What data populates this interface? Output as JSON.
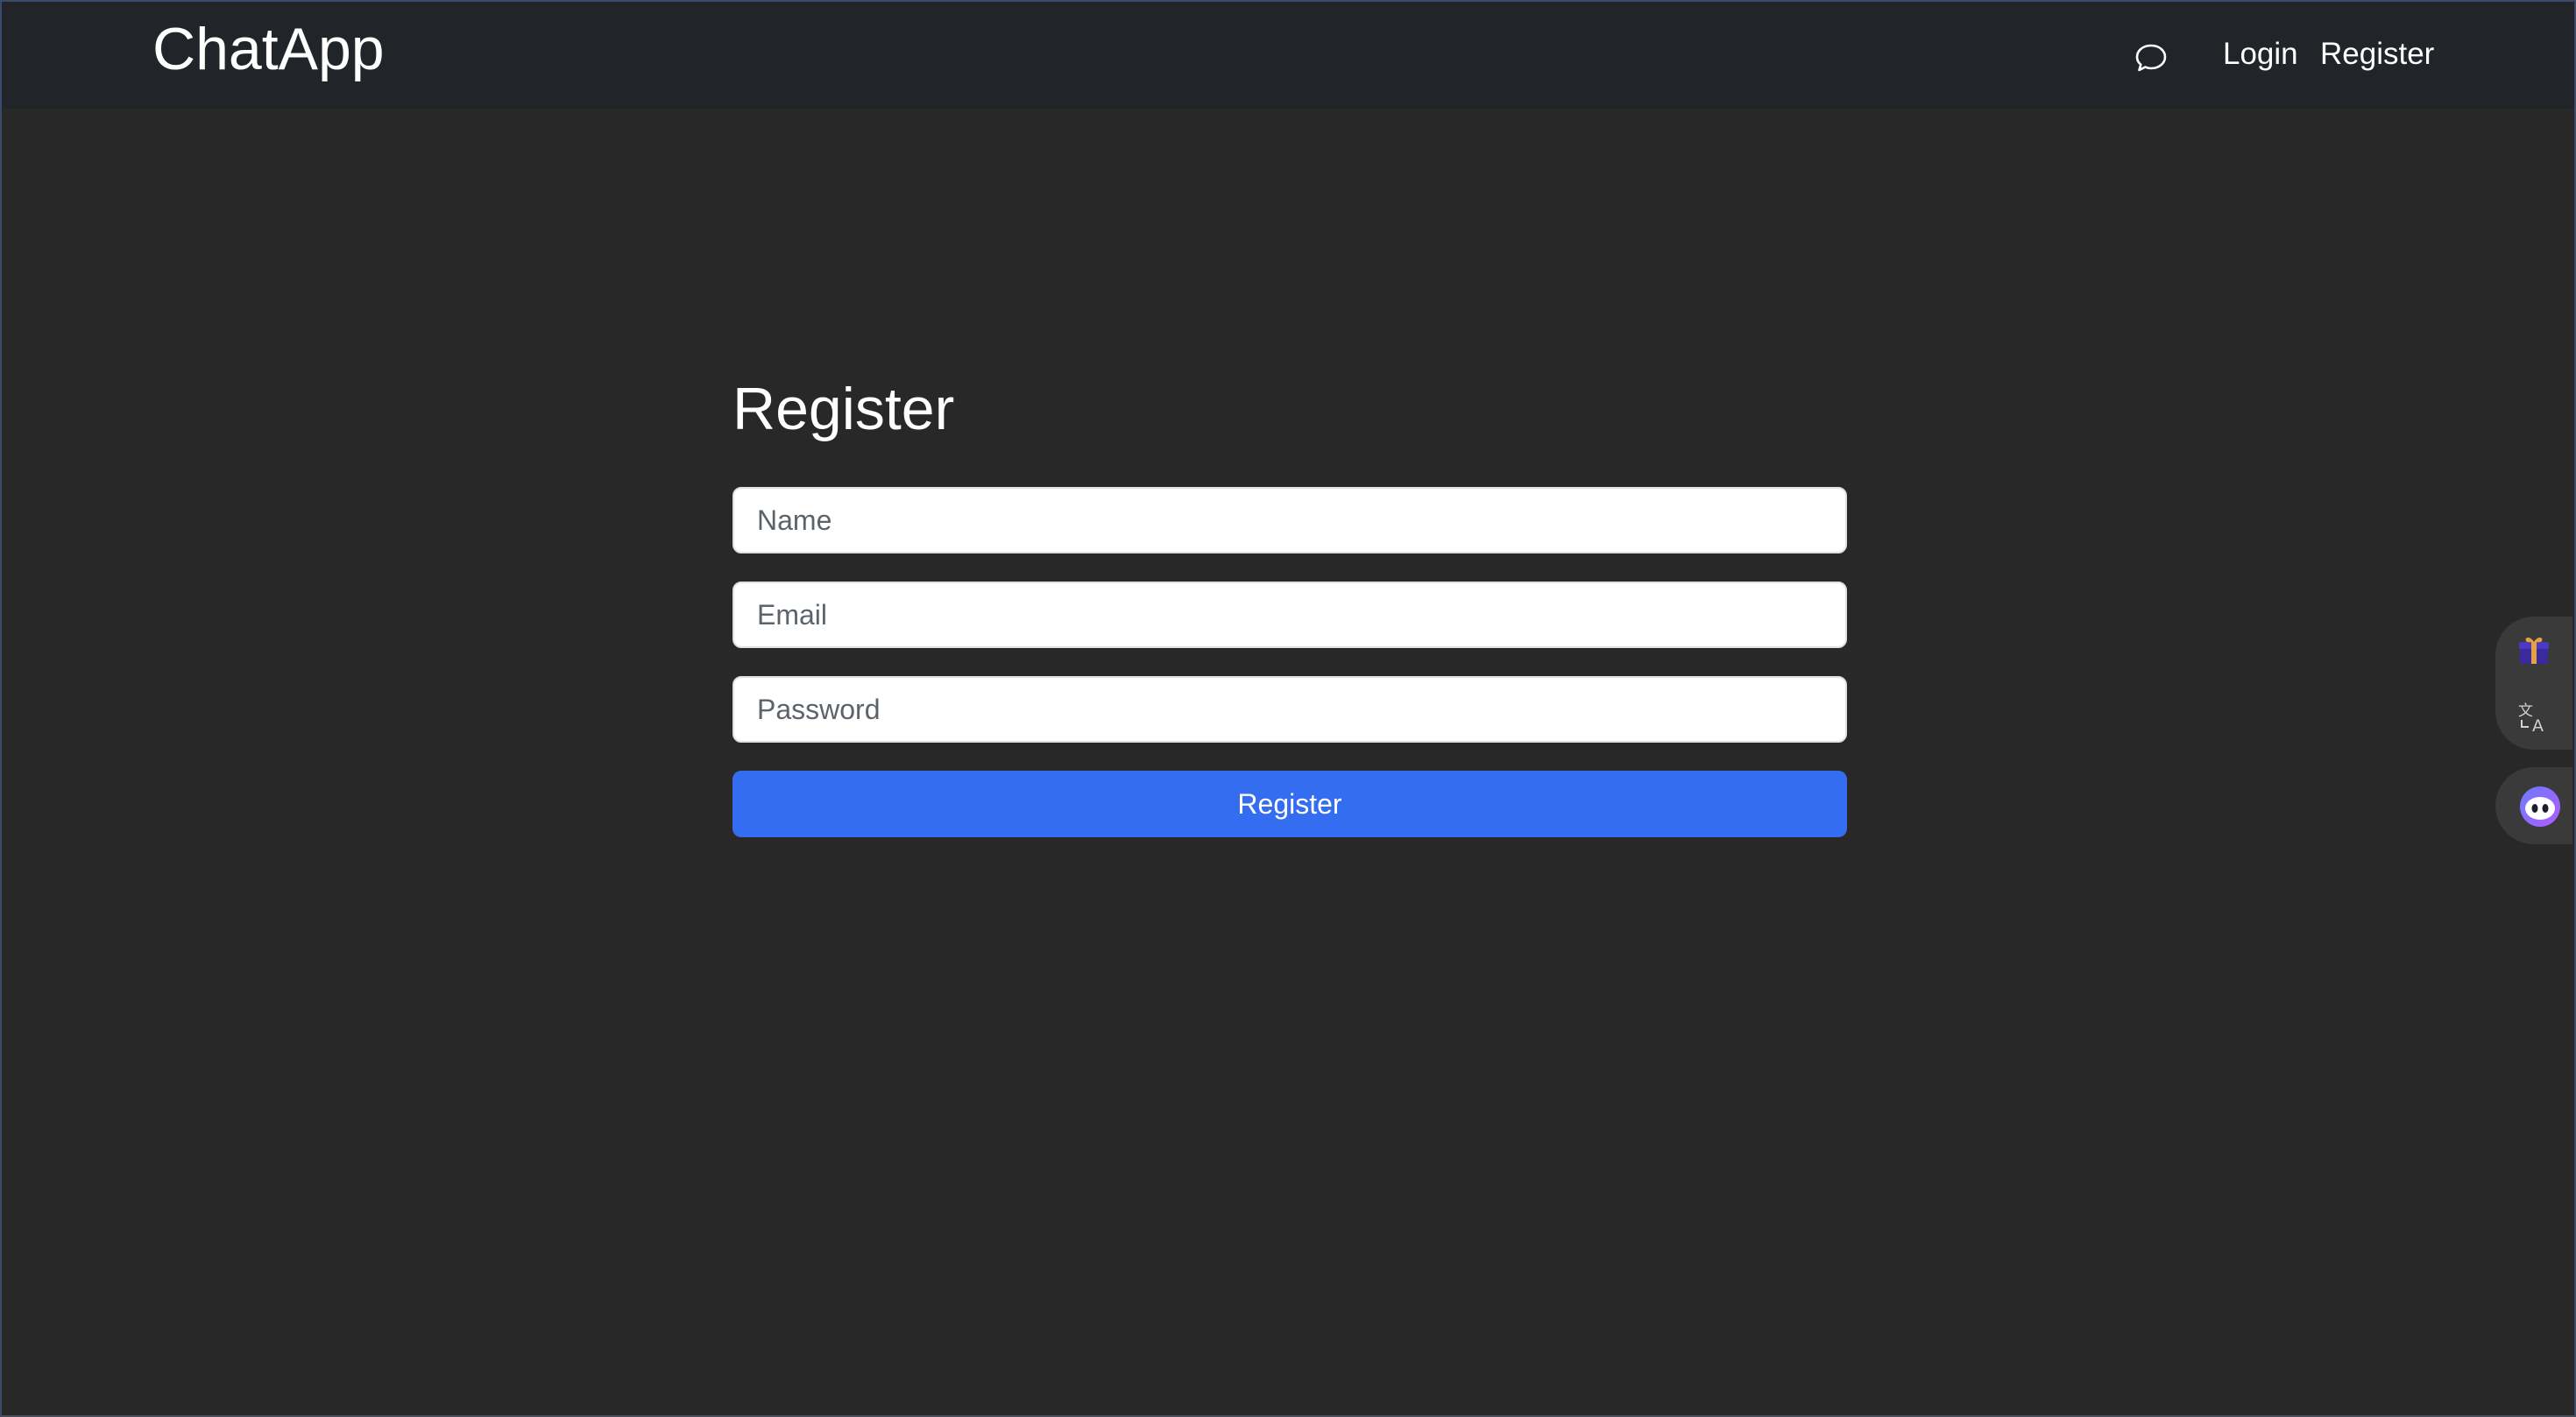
{
  "navbar": {
    "brand": "ChatApp",
    "chat_icon": "chat-bubble-icon",
    "links": [
      {
        "label": "Login"
      },
      {
        "label": "Register"
      }
    ]
  },
  "form": {
    "title": "Register",
    "name_placeholder": "Name",
    "email_placeholder": "Email",
    "password_placeholder": "Password",
    "name_value": "",
    "email_value": "",
    "password_value": "",
    "submit_label": "Register"
  },
  "side_widget": {
    "icons": [
      "gift-icon",
      "translate-icon",
      "assistant-bot-icon"
    ]
  },
  "colors": {
    "background": "#282828",
    "navbar": "#212529",
    "primary_button": "#356df1",
    "text": "#ffffff"
  }
}
